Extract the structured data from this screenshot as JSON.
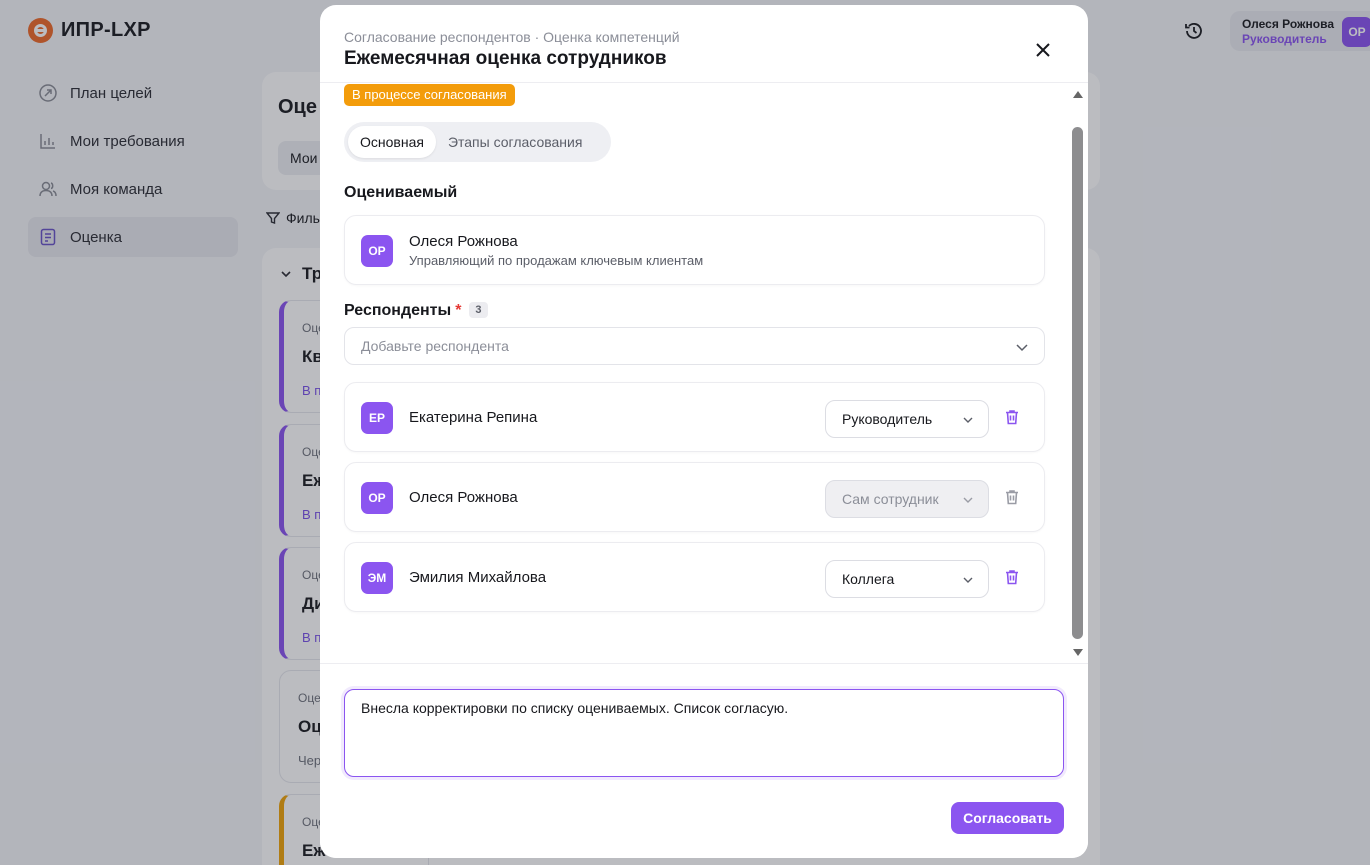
{
  "app": {
    "logo_text": "ИПР-LXP",
    "nav": [
      {
        "label": "План целей",
        "icon": "goal-arrow-icon"
      },
      {
        "label": "Мои требования",
        "icon": "requirements-chart-icon"
      },
      {
        "label": "Моя команда",
        "icon": "team-icon"
      },
      {
        "label": "Оценка",
        "icon": "assessment-list-icon",
        "active": true
      }
    ],
    "main_title": "Оце",
    "main_tab": "Мои",
    "filter_label": "Филь",
    "group_title": "Тр",
    "tasks": [
      {
        "line1": "Оце",
        "line2": "Кв",
        "line3": "В п"
      },
      {
        "line1": "Оце",
        "line2": "Еж",
        "line3": "В п"
      },
      {
        "line1": "Оце",
        "line2": "Ди",
        "line3": "В п"
      },
      {
        "line1": "Оце",
        "line2": "Оц",
        "line3": "Чер"
      },
      {
        "line1": "Оце",
        "line2": "Еж",
        "line3": ""
      }
    ],
    "user": {
      "name": "Олеся Рожнова",
      "role": "Руководитель",
      "initials": "ОР"
    }
  },
  "modal": {
    "subtitle": "Согласование респондентов · Оценка компетенций",
    "title": "Ежемесячная оценка сотрудников",
    "status": "В процессе согласования",
    "tabs": [
      {
        "label": "Основная",
        "active": true
      },
      {
        "label": "Этапы согласования",
        "active": false
      }
    ],
    "evaluated_title": "Оцениваемый",
    "evaluated": {
      "initials": "ОР",
      "name": "Олеся Рожнова",
      "position": "Управляющий по продажам ключевым клиентам"
    },
    "respondents_title": "Респонденты",
    "required_mark": "*",
    "respondents_count": "3",
    "add_placeholder": "Добавьте респондента",
    "respondents": [
      {
        "initials": "ЕР",
        "name": "Екатерина Репина",
        "role": "Руководитель",
        "disabled": false
      },
      {
        "initials": "ОР",
        "name": "Олеся Рожнова",
        "role": "Сам сотрудник",
        "disabled": true
      },
      {
        "initials": "ЭМ",
        "name": "Эмилия Михайлова",
        "role": "Коллега",
        "disabled": false
      }
    ],
    "comment": "Внесла корректировки по списку оцениваемых. Список согласую.",
    "approve_label": "Согласовать"
  },
  "colors": {
    "accent": "#8b55f0",
    "status": "#f39c0b",
    "brand": "#ee6a2a"
  }
}
